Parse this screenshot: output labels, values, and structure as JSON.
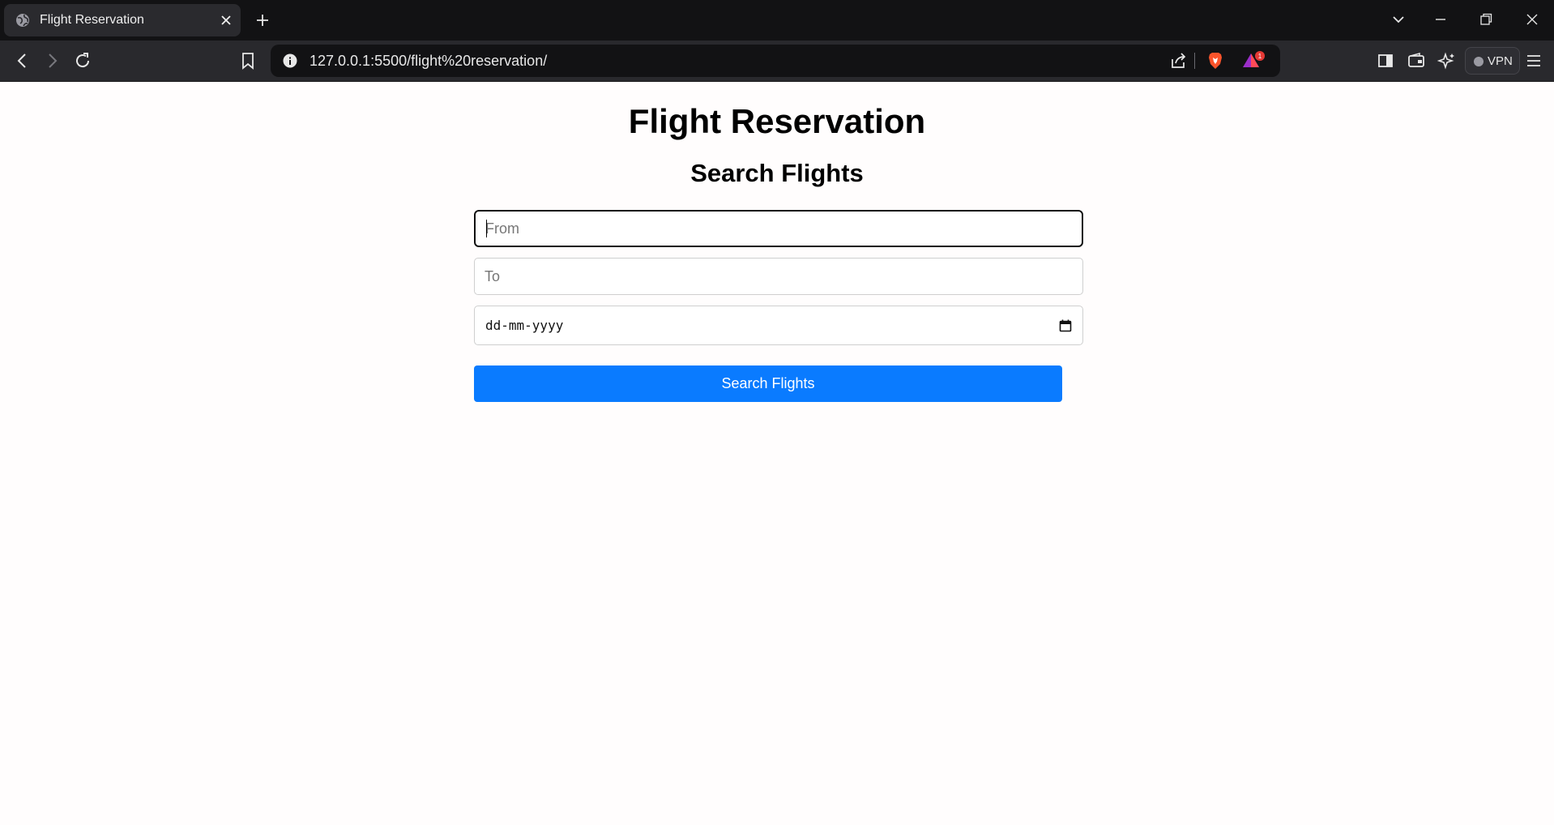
{
  "browser": {
    "tab": {
      "title": "Flight Reservation"
    },
    "address_bar": {
      "url": "127.0.0.1:5500/flight%20reservation/"
    },
    "notification_badge": "1",
    "vpn_label": "VPN",
    "colors": {
      "tabstrip": "#121214",
      "toolbar": "#29292d",
      "brave_orange": "#fb542b"
    }
  },
  "page": {
    "title": "Flight Reservation",
    "section_title": "Search Flights",
    "form": {
      "from": {
        "placeholder": "From",
        "value": ""
      },
      "to": {
        "placeholder": "To",
        "value": ""
      },
      "date": {
        "placeholder": "dd-mm-yyyy"
      },
      "submit_label": "Search Flights"
    },
    "colors": {
      "button": "#0a7bff",
      "background": "#fffdfd"
    }
  }
}
